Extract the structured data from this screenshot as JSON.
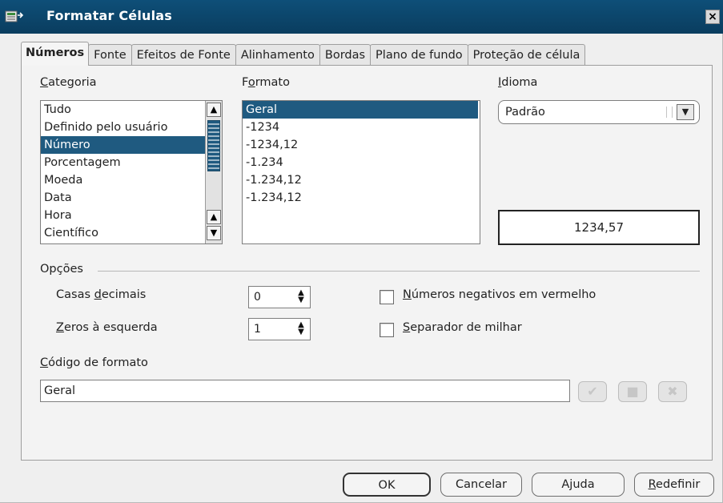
{
  "window": {
    "title": "Formatar Células",
    "close_glyph": "×"
  },
  "tabs": [
    {
      "label": "Números",
      "active": true
    },
    {
      "label": "Fonte",
      "active": false
    },
    {
      "label": "Efeitos de Fonte",
      "active": false
    },
    {
      "label": "Alinhamento",
      "active": false
    },
    {
      "label": "Bordas",
      "active": false
    },
    {
      "label": "Plano de fundo",
      "active": false
    },
    {
      "label": "Proteção de célula",
      "active": false
    }
  ],
  "categoria": {
    "label_u": "C",
    "label_rest": "ategoria",
    "items": [
      "Tudo",
      "Definido pelo usuário",
      "Número",
      "Porcentagem",
      "Moeda",
      "Data",
      "Hora",
      "Científico"
    ],
    "selected": "Número"
  },
  "formato": {
    "label_pre": "F",
    "label_u": "o",
    "label_rest": "rmato",
    "items": [
      "Geral",
      "-1234",
      "-1234,12",
      "-1.234",
      "-1.234,12",
      "-1.234,12"
    ],
    "selected": "Geral"
  },
  "idioma": {
    "label_u": "I",
    "label_rest": "dioma",
    "value": "Padrão"
  },
  "preview": {
    "value": "1234,57"
  },
  "opcoes": {
    "label": "Opções",
    "casas_decimais": {
      "label_pre": "Casas ",
      "label_u": "d",
      "label_rest": "ecimais",
      "value": "0"
    },
    "zeros_esquerda": {
      "label_u": "Z",
      "label_rest": "eros à esquerda",
      "value": "1"
    },
    "negativos_vermelho": {
      "label_u": "N",
      "label_rest": "úmeros negativos em vermelho",
      "checked": false
    },
    "separador_milhar": {
      "label_u": "S",
      "label_rest": "eparador de milhar",
      "checked": false
    }
  },
  "codigo_formato": {
    "label_u": "C",
    "label_rest": "ódigo de formato",
    "value": "Geral"
  },
  "icons": {
    "accept": "checkmark-icon",
    "comment": "comment-icon",
    "delete": "delete-icon",
    "arrow_up": "▲",
    "arrow_down": "▼"
  },
  "buttons": {
    "ok": "OK",
    "cancel": "Cancelar",
    "help_pre": "A",
    "help_u": "j",
    "help_rest": "uda",
    "reset_u": "R",
    "reset_rest": "edefinir"
  }
}
